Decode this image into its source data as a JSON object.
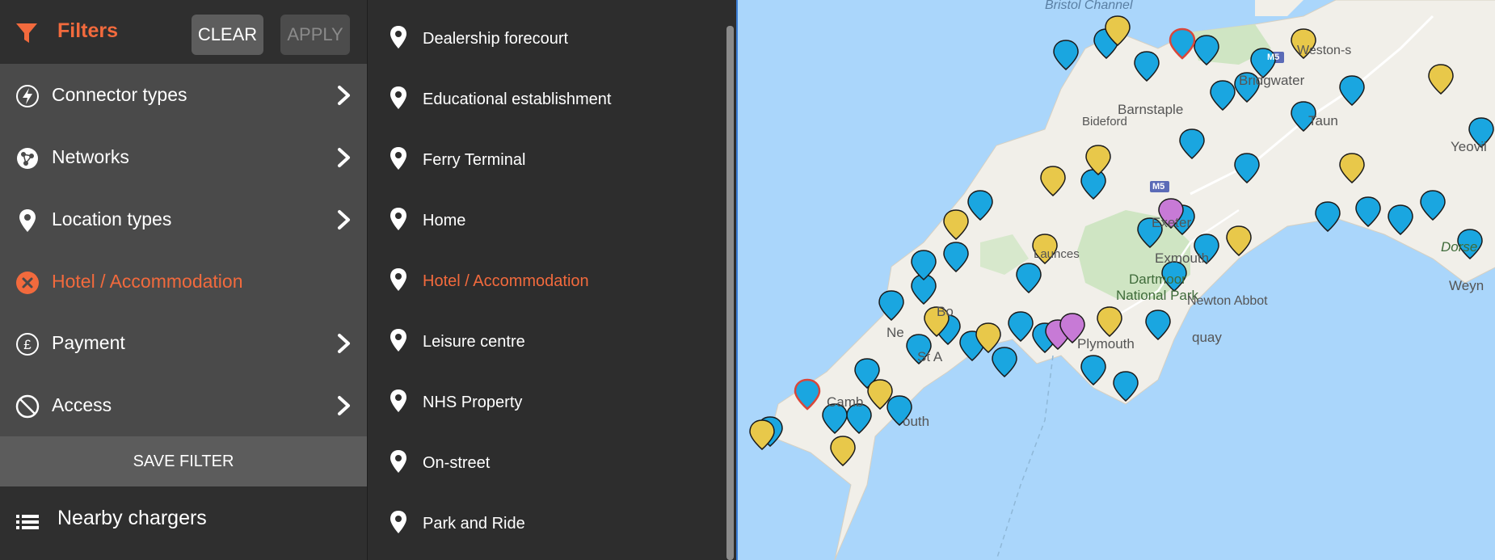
{
  "header": {
    "title": "Filters",
    "clear_label": "CLEAR",
    "apply_label": "APPLY"
  },
  "menu": {
    "items": [
      {
        "label": "Connector types",
        "icon": "bolt-icon",
        "has_chevron": true
      },
      {
        "label": "Networks",
        "icon": "network-icon",
        "has_chevron": true
      },
      {
        "label": "Location types",
        "icon": "pin-icon",
        "has_chevron": true
      },
      {
        "label": "Hotel / Accommodation",
        "icon": "remove-filter-icon",
        "has_chevron": false,
        "active": true
      },
      {
        "label": "Payment",
        "icon": "pound-icon",
        "has_chevron": true
      },
      {
        "label": "Access",
        "icon": "no-entry-icon",
        "has_chevron": true
      }
    ],
    "save_label": "SAVE FILTER"
  },
  "nearby": {
    "label": "Nearby chargers",
    "icon": "list-icon"
  },
  "locations": {
    "items": [
      {
        "label": "Dealership forecourt"
      },
      {
        "label": "Educational establishment"
      },
      {
        "label": "Ferry Terminal"
      },
      {
        "label": "Home"
      },
      {
        "label": "Hotel / Accommodation",
        "active": true
      },
      {
        "label": "Leisure centre"
      },
      {
        "label": "NHS Property"
      },
      {
        "label": "On-street"
      },
      {
        "label": "Park and Ride"
      }
    ]
  },
  "map": {
    "labels": {
      "bristol_channel": "Bristol Channel",
      "weston": "Weston-s",
      "bridgwater": "Bridgwater",
      "barnstaple": "Barnstaple",
      "bideford": "Bideford",
      "taunton": "Taun",
      "yeovil": "Yeovil",
      "m5_a": "M5",
      "m5_b": "M5",
      "exeter": "Exeter",
      "exmouth": "Exmouth",
      "launceston": "Launces",
      "dartmoor": "Dartmoor",
      "national_park": "National Park",
      "newton_abbot": "Newton Abbot",
      "torquay": "quay",
      "plymouth": "Plymouth",
      "dorset": "Dorse",
      "weymouth": "Weyn",
      "camborne": "Camb",
      "falmouth": "outh",
      "st_austell": "St A",
      "newquay": "Ne",
      "bodmin": "Bo"
    },
    "colors": {
      "sea": "#aad6fb",
      "land": "#f1efe9",
      "park": "#cfe5c3",
      "pin_blue": "#1aa6e0",
      "pin_yellow": "#e8c84a",
      "pin_purple": "#c77ad6",
      "pin_red_outline": "#d9473a"
    }
  },
  "accent_color": "#f26a3d"
}
